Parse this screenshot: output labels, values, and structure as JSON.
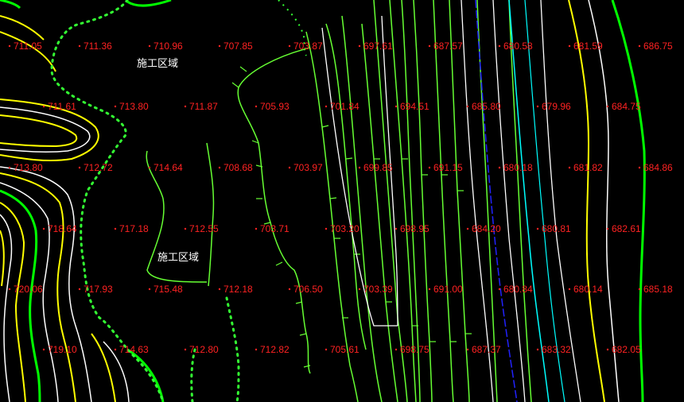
{
  "colors": {
    "background": "#000000",
    "elevation_label": "#ff2222",
    "contour_major": "#00ff00",
    "contour_minor": "#ffff00",
    "contour_white": "#ffffff",
    "slope_hatch": "#66ff33",
    "boundary_dotted": "#33ff33",
    "road_line": "#00ffff",
    "road_line_blue": "#2222ff"
  },
  "zone_labels": [
    "施工区域",
    "施工区域"
  ],
  "elevations": [
    "711.05",
    "711.36",
    "710.96",
    "707.85",
    "703.87",
    "697.61",
    "687.57",
    "680.58",
    "681.59",
    "686.75",
    "711.61",
    "713.80",
    "711.87",
    "705.93",
    "701.84",
    "694.51",
    "685.80",
    "679.96",
    "684.75",
    "713.80",
    "712.72",
    "714.64",
    "708.68",
    "703.97",
    "699.85",
    "691.15",
    "680.18",
    "681.82",
    "684.86",
    "718.64",
    "717.18",
    "712.55",
    "703.71",
    "703.20",
    "698.95",
    "684.20",
    "680.81",
    "682.61",
    "720.06",
    "717.93",
    "715.48",
    "712.18",
    "706.50",
    "703.39",
    "691.00",
    "680.84",
    "680.14",
    "685.18",
    "719.10",
    "714.63",
    "712.80",
    "712.82",
    "705.61",
    "698.75",
    "687.37",
    "683.32",
    "682.05"
  ]
}
